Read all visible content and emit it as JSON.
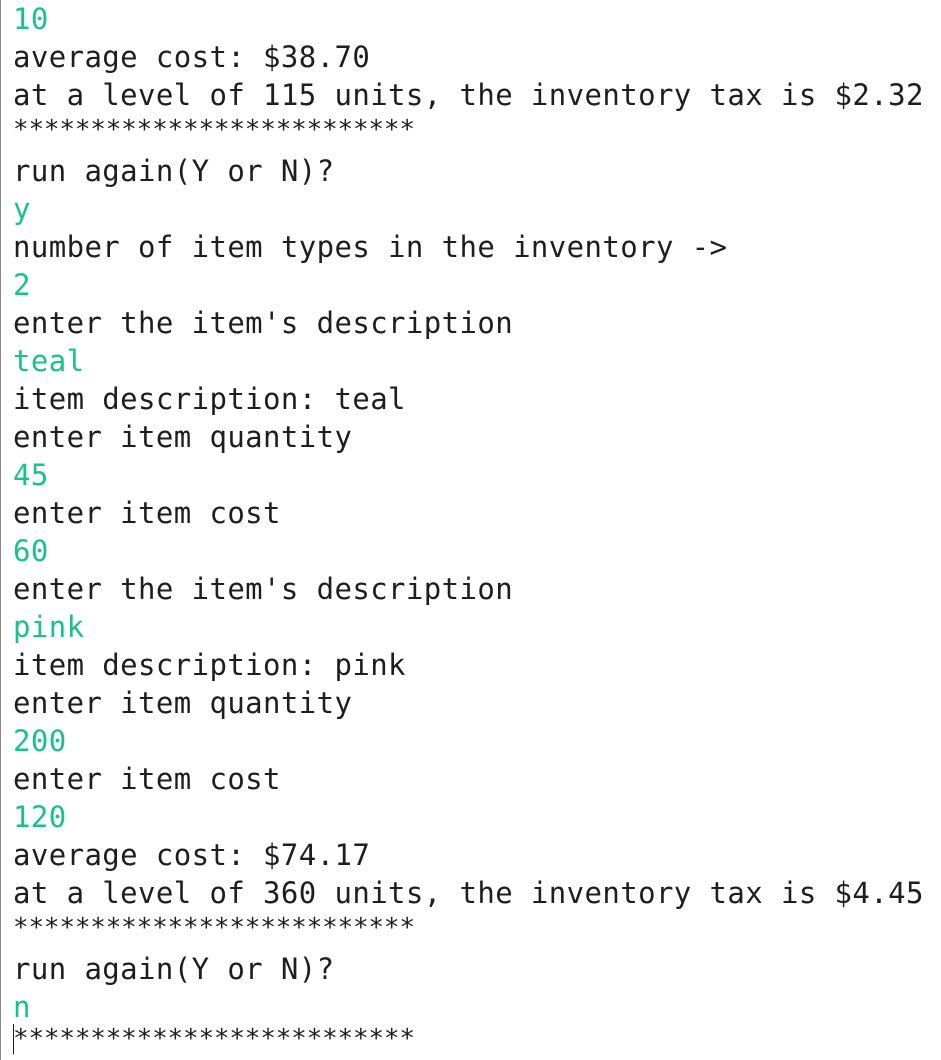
{
  "console": {
    "colors": {
      "output_text": "#1e1e1e",
      "user_input_text": "#18c28a",
      "background": "#ffffff"
    },
    "lines": [
      {
        "text": "10",
        "kind": "input"
      },
      {
        "text": "average cost: $38.70",
        "kind": "output"
      },
      {
        "text": "at a level of 115 units, the inventory tax is $2.32",
        "kind": "output"
      },
      {
        "text": "**************************",
        "kind": "separator"
      },
      {
        "text": "run again(Y or N)?",
        "kind": "prompt"
      },
      {
        "text": "y",
        "kind": "input"
      },
      {
        "text": "number of item types in the inventory ->",
        "kind": "prompt"
      },
      {
        "text": "2",
        "kind": "input"
      },
      {
        "text": "enter the item's description",
        "kind": "prompt"
      },
      {
        "text": "teal",
        "kind": "input"
      },
      {
        "text": "item description: teal",
        "kind": "output"
      },
      {
        "text": "enter item quantity",
        "kind": "prompt"
      },
      {
        "text": "45",
        "kind": "input"
      },
      {
        "text": "enter item cost",
        "kind": "prompt"
      },
      {
        "text": "60",
        "kind": "input"
      },
      {
        "text": "enter the item's description",
        "kind": "prompt"
      },
      {
        "text": "pink",
        "kind": "input"
      },
      {
        "text": "item description: pink",
        "kind": "output"
      },
      {
        "text": "enter item quantity",
        "kind": "prompt"
      },
      {
        "text": "200",
        "kind": "input"
      },
      {
        "text": "enter item cost",
        "kind": "prompt"
      },
      {
        "text": "120",
        "kind": "input"
      },
      {
        "text": "average cost: $74.17",
        "kind": "output"
      },
      {
        "text": "at a level of 360 units, the inventory tax is $4.45",
        "kind": "output"
      },
      {
        "text": "**************************",
        "kind": "separator"
      },
      {
        "text": "run again(Y or N)?",
        "kind": "prompt"
      },
      {
        "text": "n",
        "kind": "input"
      },
      {
        "text": "**************************",
        "kind": "separator"
      }
    ]
  }
}
